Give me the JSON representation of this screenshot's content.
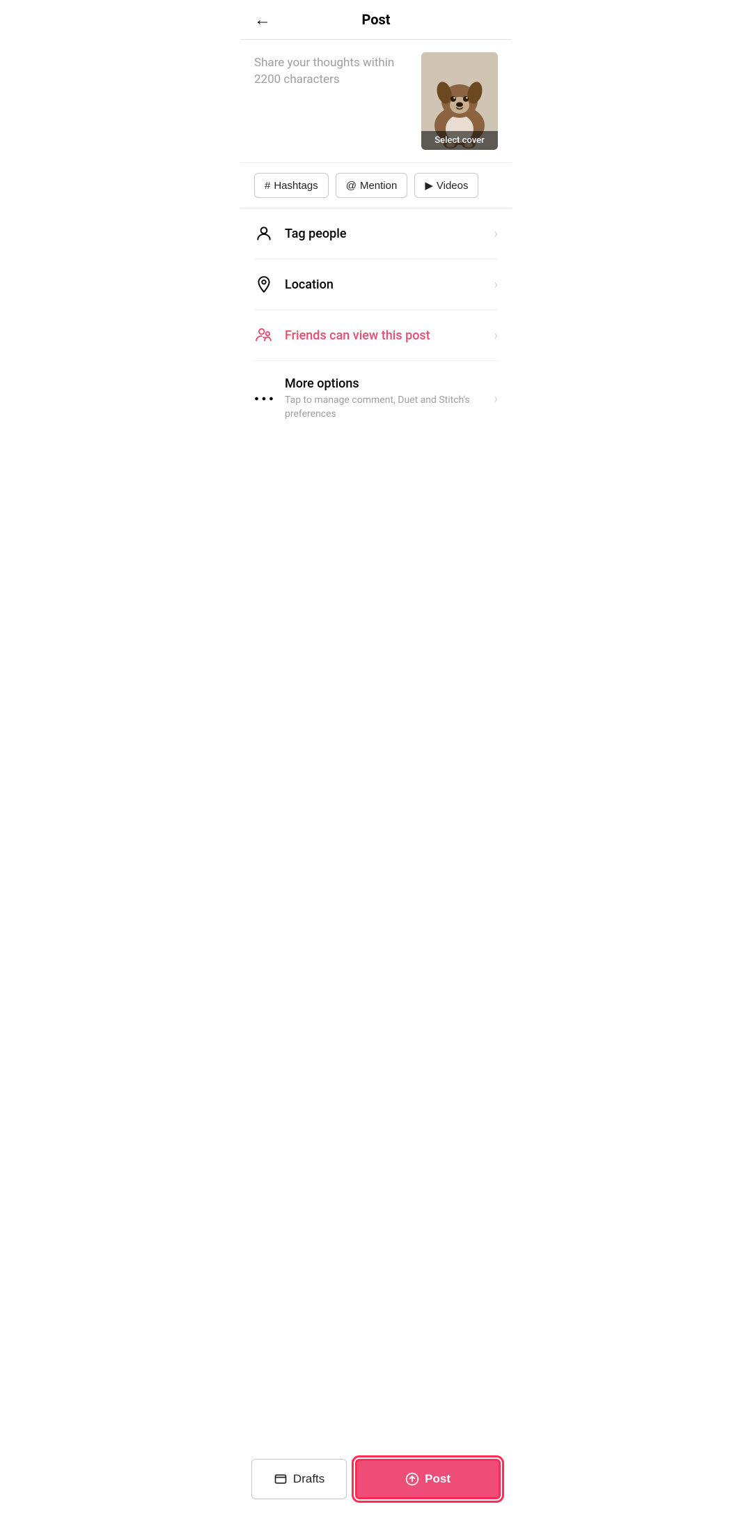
{
  "header": {
    "title": "Post",
    "back_label": "←"
  },
  "caption": {
    "placeholder": "Share your thoughts within 2200 characters"
  },
  "cover": {
    "label": "Select cover"
  },
  "tags": [
    {
      "id": "hashtags",
      "icon": "#",
      "label": "Hashtags"
    },
    {
      "id": "mention",
      "icon": "@",
      "label": "Mention"
    },
    {
      "id": "videos",
      "icon": "▶",
      "label": "Videos"
    }
  ],
  "menu_items": [
    {
      "id": "tag-people",
      "icon": "person",
      "label": "Tag people",
      "sublabel": "",
      "pink": false
    },
    {
      "id": "location",
      "icon": "location",
      "label": "Location",
      "sublabel": "",
      "pink": false
    },
    {
      "id": "privacy",
      "icon": "friends",
      "label": "Friends can view this post",
      "sublabel": "",
      "pink": true
    },
    {
      "id": "more-options",
      "icon": "dots",
      "label": "More options",
      "sublabel": "Tap to manage comment, Duet and Stitch's preferences",
      "pink": false
    }
  ],
  "bottom_bar": {
    "drafts_label": "Drafts",
    "post_label": "Post"
  },
  "colors": {
    "pink": "#ee4d78",
    "pink_border": "#ff2d55",
    "gray_text": "#9e9e9e",
    "border": "#e0e0e0"
  }
}
